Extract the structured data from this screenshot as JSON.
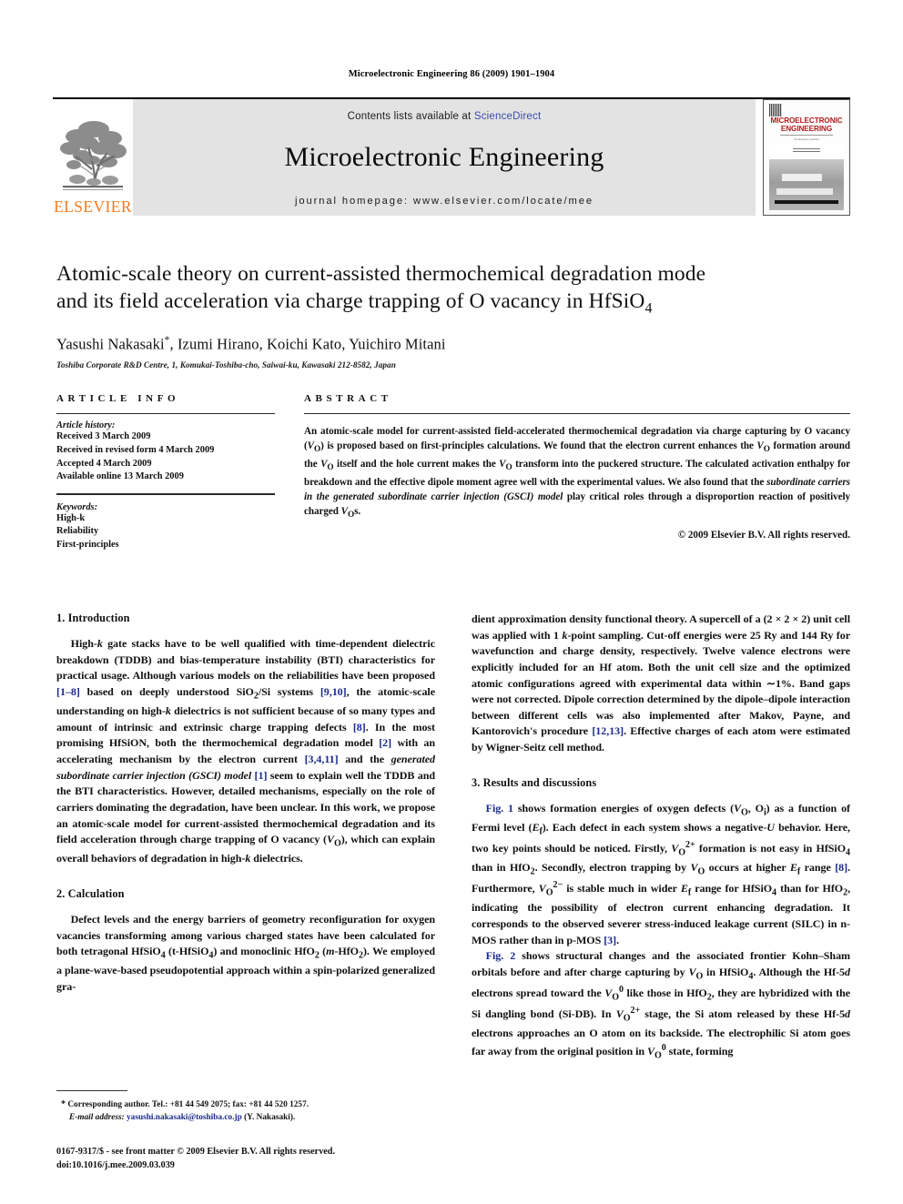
{
  "running_head": "Microelectronic Engineering 86 (2009) 1901–1904",
  "masthead": {
    "publisher_name": "ELSEVIER",
    "contents_prefix": "Contents lists available at ",
    "contents_link": "ScienceDirect",
    "journal_title": "Microelectronic Engineering",
    "homepage_line": "journal homepage: www.elsevier.com/locate/mee",
    "cover": {
      "line1": "MICROELECTRONIC",
      "line2": "ENGINEERING",
      "subtitle": "an elsevier journal"
    }
  },
  "article": {
    "title_line1": "Atomic-scale theory on current-assisted thermochemical degradation mode",
    "title_line2_a": "and its field acceleration via charge trapping of O vacancy in HfSiO",
    "title_line2_sub": "4",
    "authors": "Yasushi Nakasaki",
    "authors_star": "*",
    "authors_rest": ", Izumi Hirano, Koichi Kato, Yuichiro Mitani",
    "affiliation": "Toshiba Corporate R&D Centre, 1, Komukai-Toshiba-cho, Saiwai-ku, Kawasaki 212-8582, Japan"
  },
  "article_info": {
    "heading": "ARTICLE INFO",
    "history_label": "Article history:",
    "history": [
      "Received 3 March 2009",
      "Received in revised form 4 March 2009",
      "Accepted 4 March 2009",
      "Available online 13 March 2009"
    ],
    "keywords_label": "Keywords:",
    "keywords": [
      "High-k",
      "Reliability",
      "First-principles"
    ]
  },
  "abstract": {
    "heading": "ABSTRACT",
    "copyright": "© 2009 Elsevier B.V. All rights reserved."
  },
  "sections": {
    "introduction_heading": "1. Introduction",
    "calculation_heading": "2. Calculation",
    "results_heading": "3. Results and discussions"
  },
  "footnote": {
    "star": "*",
    "corresponding": "Corresponding author. Tel.: +81 44 549 2075; fax: +81 44 520 1257.",
    "email_label": "E-mail address:",
    "email": "yasushi.nakasaki@toshiba.co.jp",
    "email_owner": "(Y. Nakasaki)."
  },
  "legal": {
    "line1": "0167-9317/$ - see front matter © 2009 Elsevier B.V. All rights reserved.",
    "line2": "doi:10.1016/j.mee.2009.03.039"
  },
  "colors": {
    "elsevier_orange": "#F47B20",
    "link_blue": "#3b4ba8",
    "reference_blue": "#1a2a8c",
    "band_gray": "#e3e3e3",
    "cover_red": "#b01b1b"
  }
}
